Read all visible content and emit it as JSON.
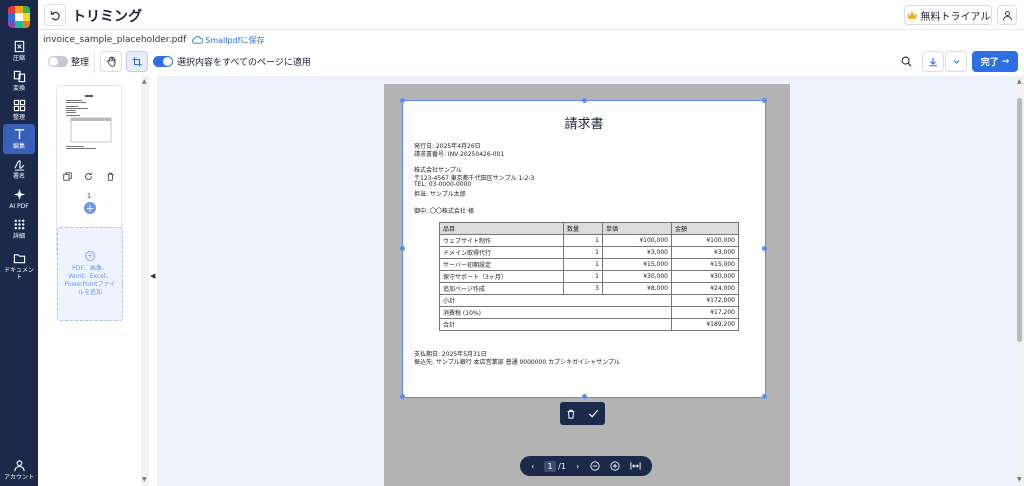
{
  "app": {
    "logo_colors": [
      "#e23b3b",
      "#f6a623",
      "#3bb54a",
      "#2f6fe6",
      "#ffffff",
      "#f6d523",
      "#8e44ad",
      "#1abc9c",
      "#e67e22"
    ]
  },
  "nav": {
    "items": [
      {
        "label": "圧縮",
        "icon": "compress-icon"
      },
      {
        "label": "変換",
        "icon": "convert-icon"
      },
      {
        "label": "整理",
        "icon": "organize-icon"
      },
      {
        "label": "編集",
        "icon": "edit-text-icon"
      },
      {
        "label": "署名",
        "icon": "signature-icon"
      },
      {
        "label": "AI PDF",
        "icon": "ai-sparkle-icon"
      },
      {
        "label": "詳細",
        "icon": "more-grid-icon"
      },
      {
        "label": "ドキュメント",
        "icon": "folder-icon"
      }
    ],
    "account_label": "アカウント"
  },
  "header": {
    "title": "トリミング",
    "trial_label": "無料トライアル"
  },
  "file": {
    "name": "invoice_sample_placeholder.pdf",
    "save_label": "Smallpdfに保存"
  },
  "toolbar": {
    "organize_label": "整理",
    "apply_all_label": "選択内容をすべてのページに適用",
    "done_label": "完了"
  },
  "thumbnails": {
    "page_number": "1",
    "dropzone_text": "PDF、画像、Word、Excel、PowerPointファイルを追加"
  },
  "document": {
    "title": "請求書",
    "issue_date": "発行日: 2025年4月26日",
    "invoice_no": "請求書番号: INV-20250426-001",
    "company": "株式会社サンプル",
    "address": "〒123-4567 東京都千代田区サンプル 1-2-3",
    "tel": "TEL: 03-0000-0000",
    "contact": "担当: サンプル太郎",
    "to": "御中: 〇〇株式会社 様",
    "table": {
      "headers": [
        "品目",
        "数量",
        "単価",
        "金額"
      ],
      "rows": [
        [
          "ウェブサイト制作",
          "1",
          "¥100,000",
          "¥100,000"
        ],
        [
          "ドメイン取得代行",
          "1",
          "¥3,000",
          "¥3,000"
        ],
        [
          "サーバー初期設定",
          "1",
          "¥15,000",
          "¥15,000"
        ],
        [
          "保守サポート（3ヶ月）",
          "1",
          "¥30,000",
          "¥30,000"
        ],
        [
          "追加ページ作成",
          "3",
          "¥8,000",
          "¥24,000"
        ]
      ],
      "summary": [
        [
          "小計",
          "¥172,000"
        ],
        [
          "消費税 (10%)",
          "¥17,200"
        ],
        [
          "合計",
          "¥189,200"
        ]
      ]
    },
    "due": "支払期日: 2025年5月31日",
    "bank": "振込先: サンプル銀行 本店営業部 普通 0000000 カブシキガイシャサンプル"
  },
  "pager": {
    "current": "1",
    "total": "/1"
  },
  "colors": {
    "nav_bg": "#1b2a4a",
    "accent": "#2f6fe6"
  }
}
